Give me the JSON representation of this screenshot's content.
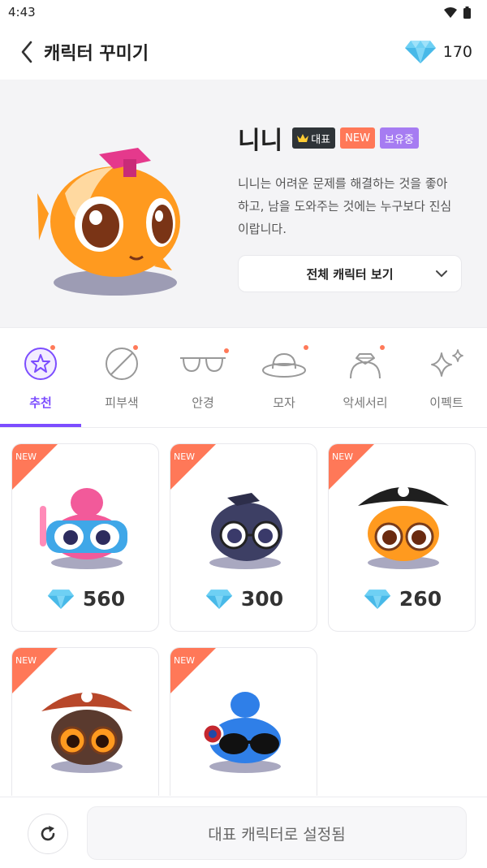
{
  "status": {
    "time": "4:43"
  },
  "header": {
    "title": "캐릭터 꾸미기",
    "gem_count": "170"
  },
  "character": {
    "name": "니니",
    "badge_main": "대표",
    "badge_new": "NEW",
    "badge_owned": "보유중",
    "description": "니니는 어려운 문제를 해결하는 것을 좋아하고, 남을 도와주는 것에는 누구보다 진심이랍니다.",
    "view_all_label": "전체 캐릭터 보기"
  },
  "tabs": [
    {
      "label": "추천",
      "icon": "star-icon",
      "active": true,
      "dot": true
    },
    {
      "label": "피부색",
      "icon": "no-skin-icon",
      "active": false,
      "dot": true
    },
    {
      "label": "안경",
      "icon": "glasses-icon",
      "active": false,
      "dot": true
    },
    {
      "label": "모자",
      "icon": "hat-icon",
      "active": false,
      "dot": true
    },
    {
      "label": "악세서리",
      "icon": "tiara-icon",
      "active": false,
      "dot": true
    },
    {
      "label": "이펙트",
      "icon": "sparkle-icon",
      "active": false,
      "dot": false
    }
  ],
  "items": [
    {
      "new_label": "NEW",
      "price": "560",
      "art": "pink-octopus-snorkel"
    },
    {
      "new_label": "NEW",
      "price": "300",
      "art": "navy-fish-glasses"
    },
    {
      "new_label": "NEW",
      "price": "260",
      "art": "orange-fish-pirate"
    },
    {
      "new_label": "NEW",
      "price": "",
      "art": "brown-fish-pirate"
    },
    {
      "new_label": "NEW",
      "price": "",
      "art": "blue-octopus-sunglasses"
    }
  ],
  "bottom": {
    "set_main_label": "대표 캐릭터로 설정됨"
  },
  "colors": {
    "accent": "#7c4dff",
    "new": "#ff7858",
    "owned": "#a67cf2",
    "gem": "#5cc8f0"
  }
}
